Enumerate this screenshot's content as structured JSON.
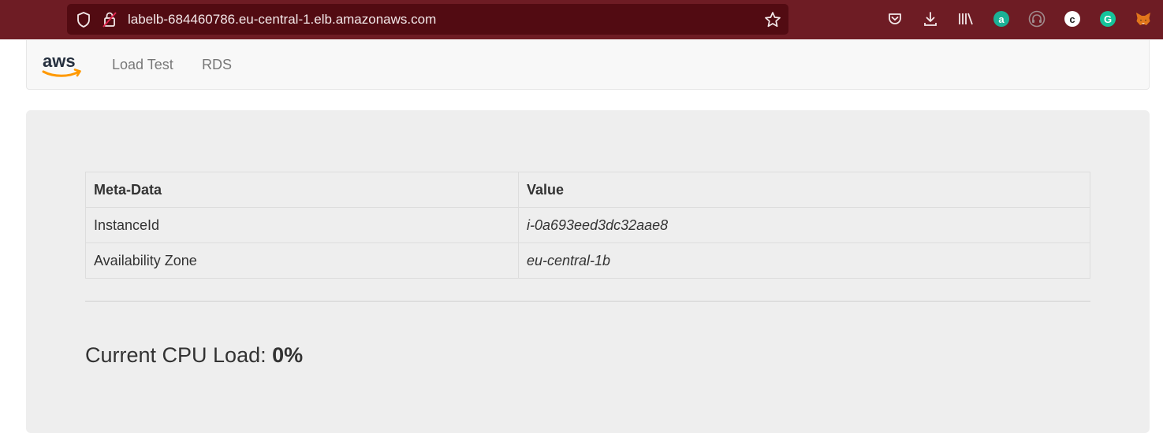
{
  "browser": {
    "url": "labelb-684460786.eu-central-1.elb.amazonaws.com",
    "toolbar_icons": [
      "pocket-icon",
      "download-icon",
      "library-icon",
      "extension-a-icon",
      "extension-headphones-icon",
      "extension-c-icon",
      "grammarly-icon",
      "metamask-icon"
    ],
    "extension_letters": {
      "a": "a",
      "c": "c",
      "g": "G"
    },
    "colors": {
      "toolbar": "#6e1c24",
      "urlbar": "#520b12"
    }
  },
  "navbar": {
    "logo": "aws",
    "links": [
      {
        "label": "Load Test"
      },
      {
        "label": "RDS"
      }
    ]
  },
  "meta_table": {
    "headers": [
      "Meta-Data",
      "Value"
    ],
    "rows": [
      {
        "key": "InstanceId",
        "value": "i-0a693eed3dc32aae8"
      },
      {
        "key": "Availability Zone",
        "value": "eu-central-1b"
      }
    ]
  },
  "cpu": {
    "label": "Current CPU Load: ",
    "value": "0%"
  }
}
